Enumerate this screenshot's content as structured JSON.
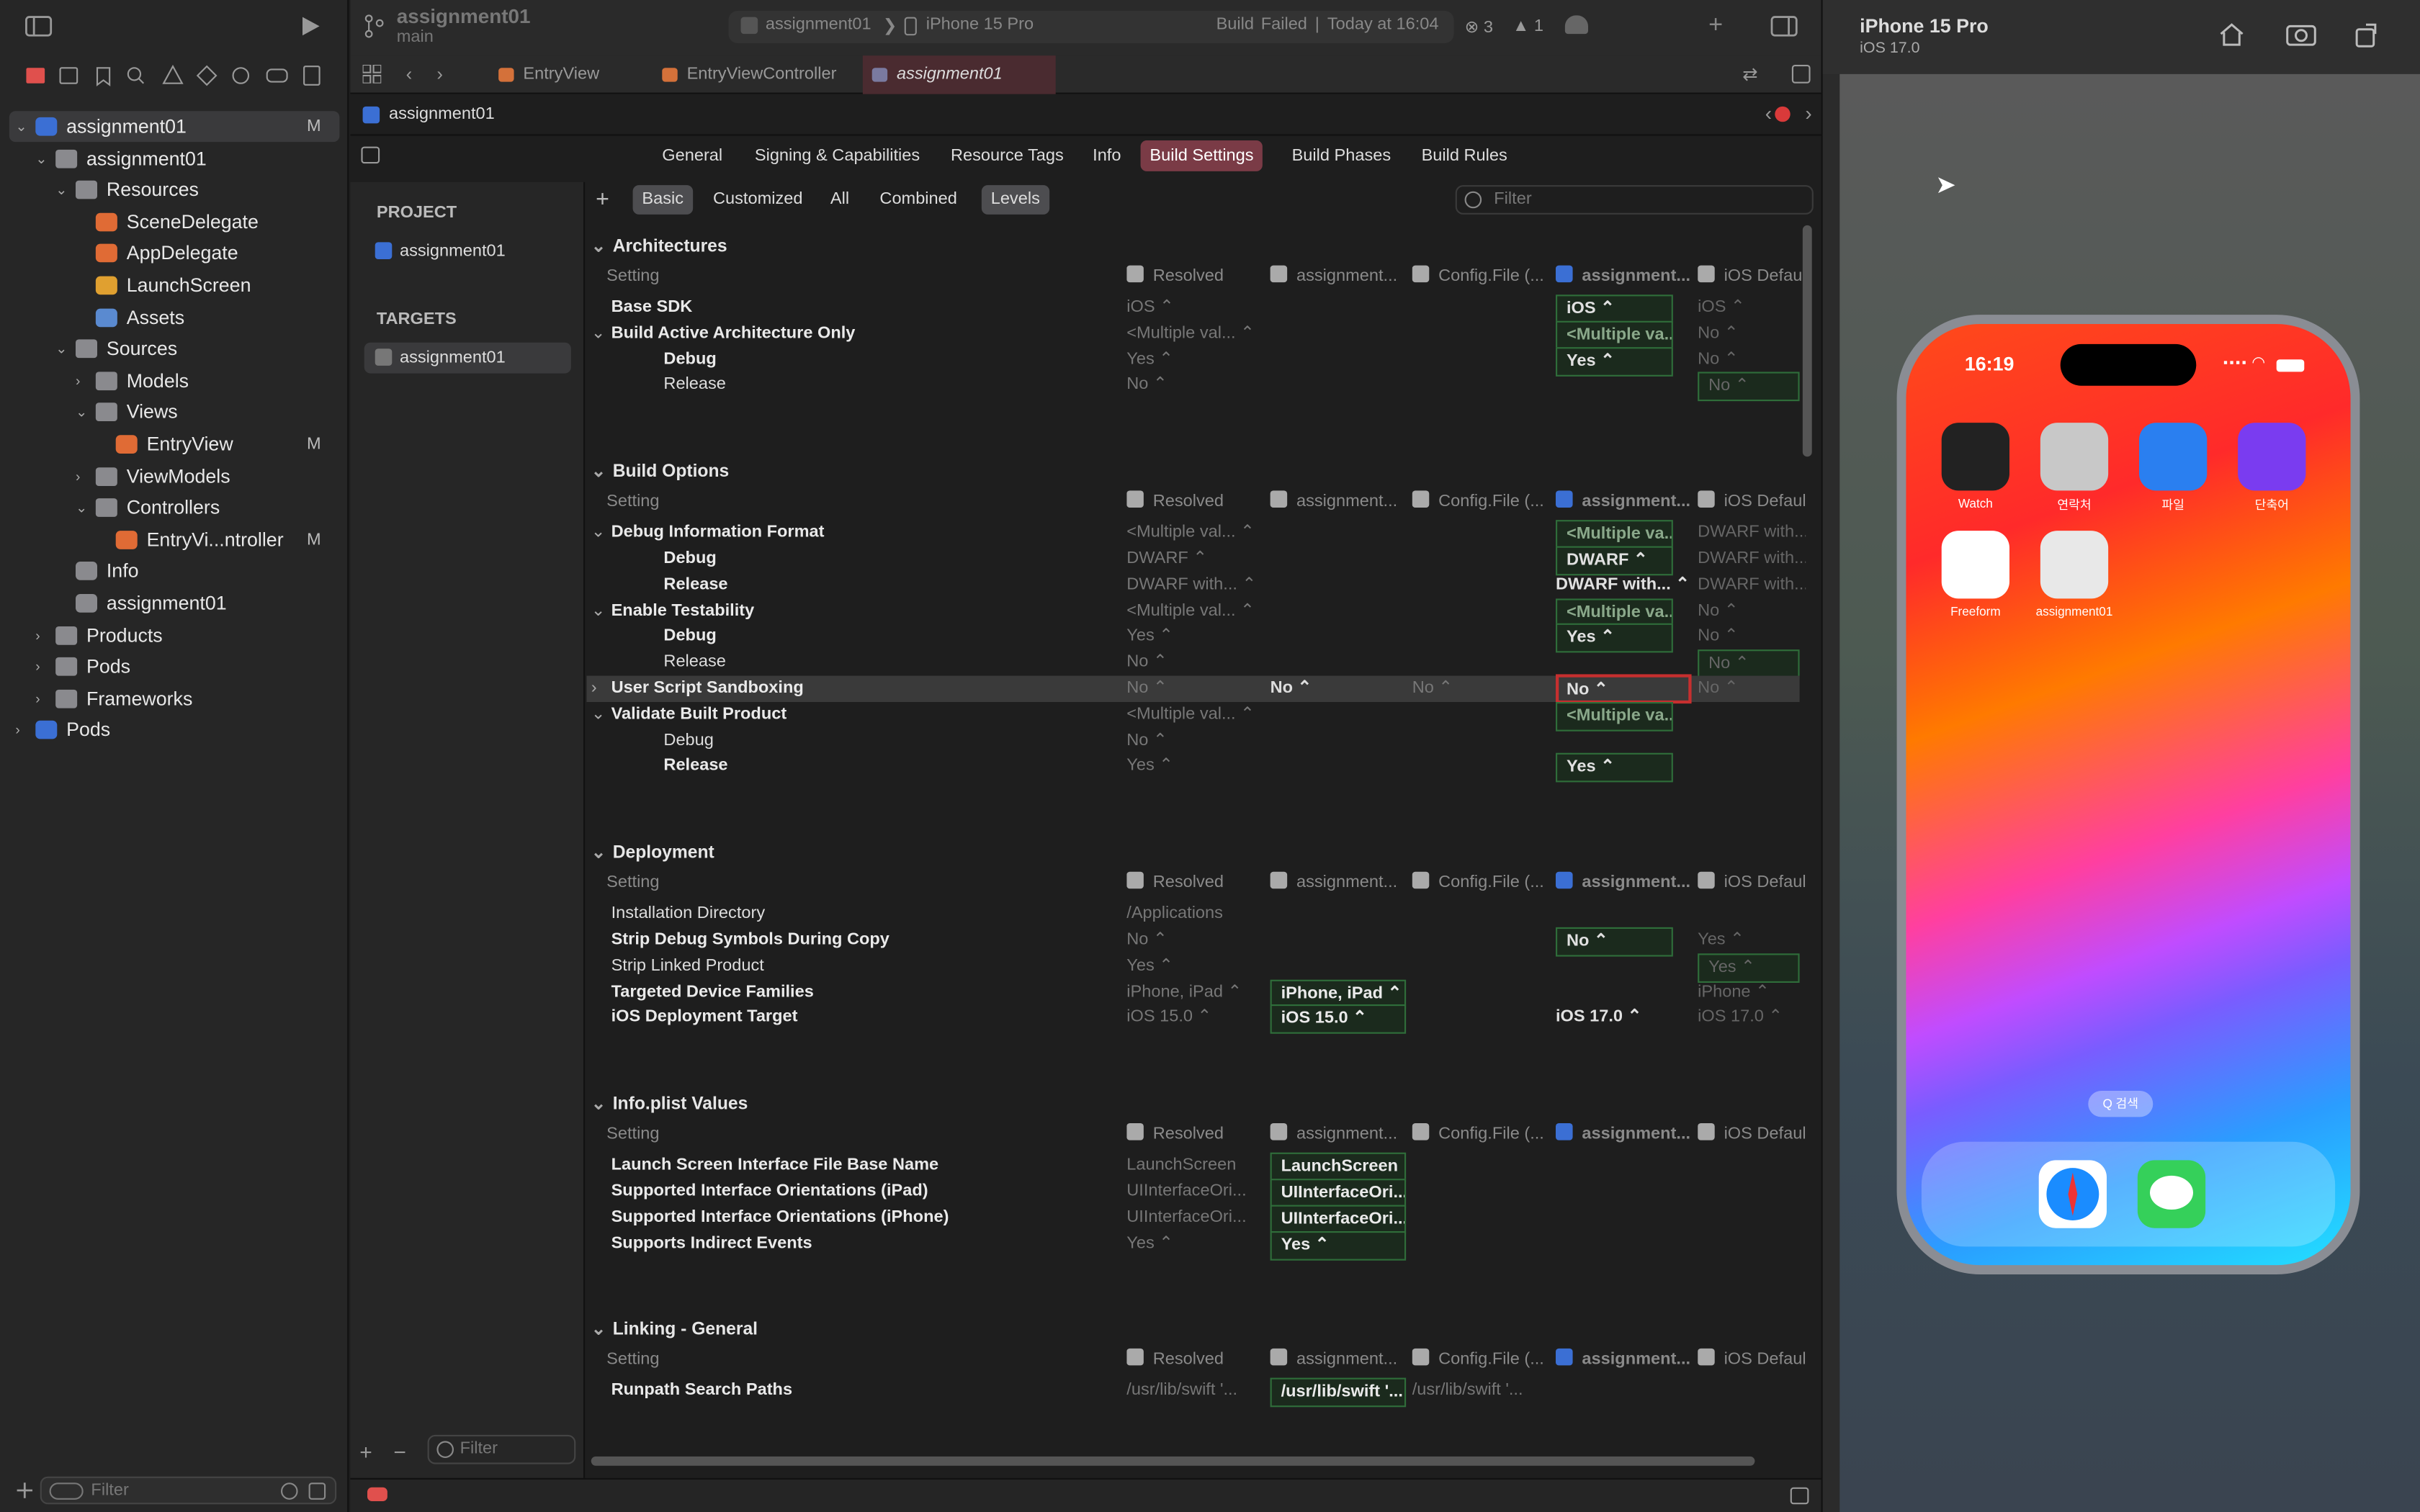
{
  "toolbar": {
    "project": "assignment01",
    "branch": "main",
    "scheme": "assignment01",
    "device": "iPhone 15 Pro",
    "status_label": "Build",
    "status_value": "Failed",
    "status_time": "Today at 16:04",
    "errors": "3",
    "warnings": "1"
  },
  "navigator": {
    "items": [
      {
        "label": "assignment01",
        "level": 0,
        "disc": "v",
        "icon": "project",
        "badge": "M",
        "sel": true
      },
      {
        "label": "assignment01",
        "level": 1,
        "disc": "v",
        "icon": "folder",
        "badge": ""
      },
      {
        "label": "Resources",
        "level": 2,
        "disc": "v",
        "icon": "folder",
        "badge": ""
      },
      {
        "label": "SceneDelegate",
        "level": 3,
        "disc": "",
        "icon": "swift",
        "badge": ""
      },
      {
        "label": "AppDelegate",
        "level": 3,
        "disc": "",
        "icon": "swift",
        "badge": ""
      },
      {
        "label": "LaunchScreen",
        "level": 3,
        "disc": "",
        "icon": "storyboard",
        "badge": ""
      },
      {
        "label": "Assets",
        "level": 3,
        "disc": "",
        "icon": "assets",
        "badge": ""
      },
      {
        "label": "Sources",
        "level": 2,
        "disc": "v",
        "icon": "folder",
        "badge": ""
      },
      {
        "label": "Models",
        "level": 3,
        "disc": ">",
        "icon": "folder",
        "badge": ""
      },
      {
        "label": "Views",
        "level": 3,
        "disc": "v",
        "icon": "folder",
        "badge": ""
      },
      {
        "label": "EntryView",
        "level": 4,
        "disc": "",
        "icon": "swift",
        "badge": "M"
      },
      {
        "label": "ViewModels",
        "level": 3,
        "disc": ">",
        "icon": "folder",
        "badge": ""
      },
      {
        "label": "Controllers",
        "level": 3,
        "disc": "v",
        "icon": "folder",
        "badge": ""
      },
      {
        "label": "EntryVi...ntroller",
        "level": 4,
        "disc": "",
        "icon": "swift",
        "badge": "M"
      },
      {
        "label": "Info",
        "level": 2,
        "disc": "",
        "icon": "plist",
        "badge": ""
      },
      {
        "label": "assignment01",
        "level": 2,
        "disc": "",
        "icon": "entitle",
        "badge": ""
      },
      {
        "label": "Products",
        "level": 1,
        "disc": ">",
        "icon": "folder",
        "badge": ""
      },
      {
        "label": "Pods",
        "level": 1,
        "disc": ">",
        "icon": "folder",
        "badge": ""
      },
      {
        "label": "Frameworks",
        "level": 1,
        "disc": ">",
        "icon": "folder",
        "badge": ""
      },
      {
        "label": "Pods",
        "level": 0,
        "disc": ">",
        "icon": "project",
        "badge": ""
      }
    ],
    "filter_placeholder": "Filter"
  },
  "tabs": [
    {
      "label": "EntryView",
      "active": false
    },
    {
      "label": "EntryViewController",
      "active": false
    },
    {
      "label": "assignment01",
      "active": true
    }
  ],
  "jumpbar": {
    "file": "assignment01"
  },
  "setting_tabs": [
    "General",
    "Signing & Capabilities",
    "Resource Tags",
    "Info",
    "Build Settings",
    "Build Phases",
    "Build Rules"
  ],
  "setting_active": "Build Settings",
  "targets_pane": {
    "project_head": "PROJECT",
    "project_item": "assignment01",
    "targets_head": "TARGETS",
    "target_item": "assignment01",
    "filter_placeholder": "Filter"
  },
  "filters": {
    "buttons": [
      "Basic",
      "Customized",
      "All",
      "Combined",
      "Levels"
    ],
    "active": [
      "Basic",
      "Levels"
    ],
    "search_placeholder": "Filter"
  },
  "columns": {
    "setting": "Setting",
    "resolved": "Resolved",
    "target": "assignment...",
    "config": "Config.File (...",
    "project": "assignment...",
    "ios": "iOS Defaul"
  },
  "sections": [
    {
      "title": "Architectures",
      "rows": [
        {
          "n": "Base SDK",
          "style": "bold",
          "r": "iOS ⌃",
          "a": "",
          "c": "",
          "p": "iOS ⌃",
          "pbox": "g",
          "d": "iOS ⌃"
        },
        {
          "n": "Build Active Architecture Only",
          "style": "bold",
          "disc": "v",
          "r": "<Multiple val... ⌃",
          "a": "",
          "c": "",
          "p": "<Multiple va... ⌃",
          "pbox": "g",
          "d": "No ⌃"
        },
        {
          "n": "Debug",
          "style": "sub",
          "r": "Yes ⌃",
          "a": "",
          "c": "",
          "p": "Yes ⌃",
          "pbox": "g",
          "d": "No ⌃"
        },
        {
          "n": "Release",
          "style": "subn",
          "r": "No ⌃",
          "a": "",
          "c": "",
          "p": "",
          "pbox": "",
          "d": "No ⌃",
          "dbox": "g"
        }
      ]
    },
    {
      "title": "Build Options",
      "rows": [
        {
          "n": "Debug Information Format",
          "style": "bold",
          "disc": "v",
          "r": "<Multiple val... ⌃",
          "a": "",
          "c": "",
          "p": "<Multiple va... ⌃",
          "pbox": "g",
          "d": "DWARF with..."
        },
        {
          "n": "Debug",
          "style": "sub",
          "r": "DWARF ⌃",
          "a": "",
          "c": "",
          "p": "DWARF ⌃",
          "pbox": "g",
          "d": "DWARF with..."
        },
        {
          "n": "Release",
          "style": "sub",
          "r": "DWARF with... ⌃",
          "a": "",
          "c": "",
          "p": "DWARF with... ⌃",
          "pbox": "",
          "d": "DWARF with..."
        },
        {
          "n": "Enable Testability",
          "style": "bold",
          "disc": "v",
          "r": "<Multiple val... ⌃",
          "a": "",
          "c": "",
          "p": "<Multiple va... ⌃",
          "pbox": "g",
          "d": "No ⌃"
        },
        {
          "n": "Debug",
          "style": "sub",
          "r": "Yes ⌃",
          "a": "",
          "c": "",
          "p": "Yes ⌃",
          "pbox": "g",
          "d": "No ⌃"
        },
        {
          "n": "Release",
          "style": "subn",
          "r": "No ⌃",
          "a": "",
          "c": "",
          "p": "",
          "pbox": "",
          "d": "No ⌃",
          "dbox": "g"
        },
        {
          "n": "User Script Sandboxing",
          "style": "bold",
          "disc": ">",
          "hl": true,
          "r": "No ⌃",
          "a": "No ⌃",
          "c": "No ⌃",
          "p": "No ⌃",
          "pbox": "r",
          "d": "No ⌃"
        },
        {
          "n": "Validate Built Product",
          "style": "bold",
          "disc": "v",
          "r": "<Multiple val... ⌃",
          "a": "",
          "c": "",
          "p": "<Multiple va... ⌃",
          "pbox": "g",
          "d": ""
        },
        {
          "n": "Debug",
          "style": "subn",
          "r": "No ⌃",
          "a": "",
          "c": "",
          "p": "",
          "pbox": "",
          "d": ""
        },
        {
          "n": "Release",
          "style": "sub",
          "r": "Yes ⌃",
          "a": "",
          "c": "",
          "p": "Yes ⌃",
          "pbox": "g",
          "d": ""
        }
      ]
    },
    {
      "title": "Deployment",
      "rows": [
        {
          "n": "Installation Directory",
          "style": "norm",
          "r": "/Applications",
          "a": "",
          "c": "",
          "p": "",
          "pbox": "",
          "d": ""
        },
        {
          "n": "Strip Debug Symbols During Copy",
          "style": "bold",
          "r": "No ⌃",
          "a": "",
          "c": "",
          "p": "No ⌃",
          "pbox": "g",
          "d": "Yes ⌃"
        },
        {
          "n": "Strip Linked Product",
          "style": "norm",
          "r": "Yes ⌃",
          "a": "",
          "c": "",
          "p": "",
          "pbox": "",
          "d": "Yes ⌃",
          "dbox": "g"
        },
        {
          "n": "Targeted Device Families",
          "style": "bold",
          "r": "iPhone, iPad ⌃",
          "a": "iPhone, iPad ⌃",
          "abox": "g",
          "c": "",
          "p": "",
          "pbox": "",
          "d": "iPhone ⌃"
        },
        {
          "n": "iOS Deployment Target",
          "style": "bold",
          "r": "iOS 15.0 ⌃",
          "a": "iOS 15.0 ⌃",
          "abox": "g",
          "c": "",
          "p": "iOS 17.0 ⌃",
          "pbox": "",
          "d": "iOS 17.0 ⌃"
        }
      ]
    },
    {
      "title": "Info.plist Values",
      "rows": [
        {
          "n": "Launch Screen Interface File Base Name",
          "style": "bold",
          "r": "LaunchScreen",
          "a": "LaunchScreen",
          "abox": "g",
          "c": "",
          "p": "",
          "pbox": "",
          "d": ""
        },
        {
          "n": "Supported Interface Orientations (iPad)",
          "style": "bold",
          "r": "UIInterfaceOri...",
          "a": "UIInterfaceOri...",
          "abox": "g",
          "c": "",
          "p": "",
          "pbox": "",
          "d": ""
        },
        {
          "n": "Supported Interface Orientations (iPhone)",
          "style": "bold",
          "r": "UIInterfaceOri...",
          "a": "UIInterfaceOri...",
          "abox": "g",
          "c": "",
          "p": "",
          "pbox": "",
          "d": ""
        },
        {
          "n": "Supports Indirect Events",
          "style": "bold",
          "r": "Yes ⌃",
          "a": "Yes ⌃",
          "abox": "g",
          "c": "",
          "p": "",
          "pbox": "",
          "d": ""
        }
      ]
    },
    {
      "title": "Linking - General",
      "rows": [
        {
          "n": "Runpath Search Paths",
          "style": "bold",
          "r": "/usr/lib/swift '...",
          "a": "/usr/lib/swift '...",
          "abox": "g",
          "c": "/usr/lib/swift '...",
          "p": "",
          "pbox": "",
          "d": ""
        }
      ]
    }
  ],
  "simulator": {
    "device": "iPhone 15 Pro",
    "os": "iOS 17.0",
    "time": "16:19",
    "apps": [
      {
        "label": "Watch",
        "color": "#222"
      },
      {
        "label": "연락처",
        "color": "#c8c8c8"
      },
      {
        "label": "파일",
        "color": "#2a7ff0"
      },
      {
        "label": "단축어",
        "color": "#7a3cf0"
      },
      {
        "label": "Freeform",
        "color": "#fff"
      },
      {
        "label": "assignment01",
        "color": "#e8e8e8"
      }
    ],
    "search": "Q 검색"
  }
}
